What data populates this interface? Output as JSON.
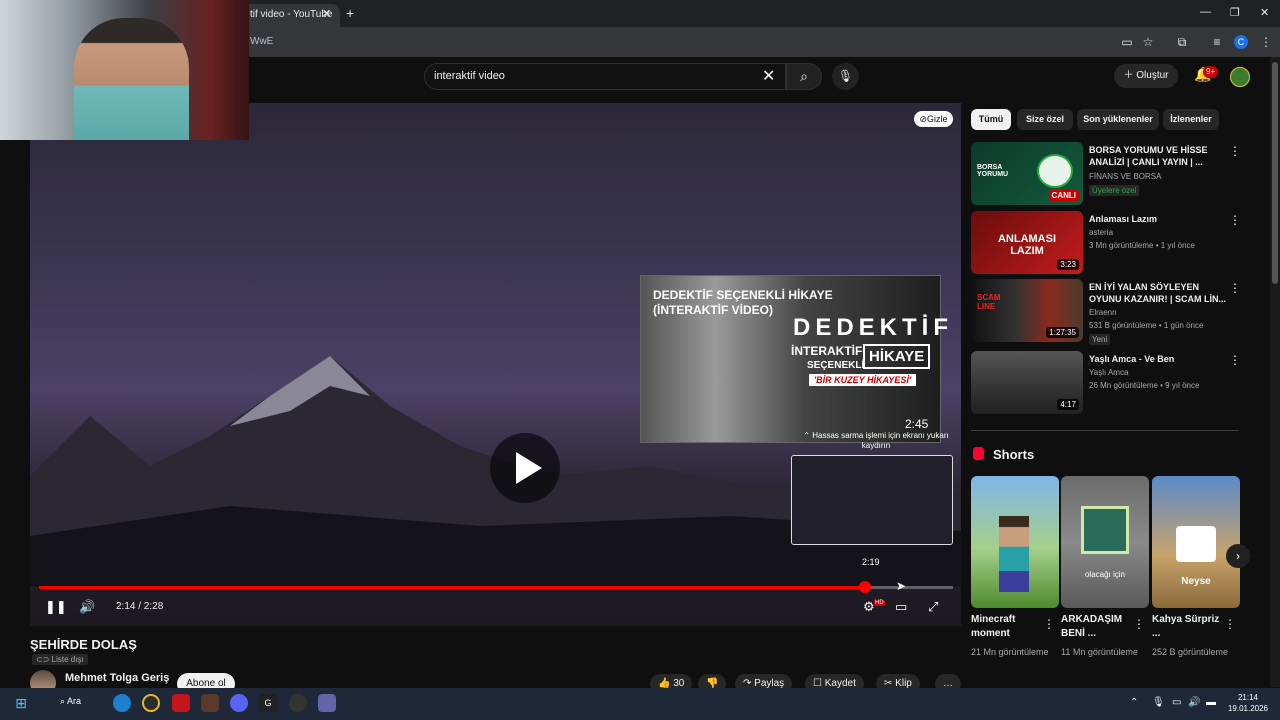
{
  "browser": {
    "tab_title": "tif video - YouTube",
    "tab_close": "✕",
    "new_tab": "+",
    "url": "WwE",
    "profile_initial": "C",
    "window_controls": [
      "—",
      "❐",
      "✕"
    ]
  },
  "header": {
    "search_value": "interaktif video",
    "search_clear": "✕",
    "create_label": "Oluştur",
    "notif_count": "9+"
  },
  "player": {
    "hide_label": "Gizle",
    "current_time": "2:14 / 2:28",
    "progress_fraction": 0.905,
    "preview_time": "2:19",
    "hd_badge": "HD"
  },
  "endcard": {
    "title": "DEDEKTİF SEÇENEKLİ HİKAYE (İNTERAKTİF VİDEO)",
    "big_word": "DEDEKTİF",
    "interaktif": "İNTERAKTİF",
    "hikaye": "HİKAYE",
    "secenekli": "SEÇENEKLİ",
    "tagline": "'BİR KUZEY HİKAYESİ'",
    "duration": "2:45",
    "scroll_note": "Hassas sarma işlemi için ekranı yukarı kaydırın"
  },
  "video": {
    "title": "ŞEHİRDE DOLAŞ",
    "visibility": "Liste dışı",
    "channel": "Mehmet Tolga Geriş",
    "subscribe": "Abone ol",
    "likes": "30",
    "share": "Paylaş",
    "save": "Kaydet",
    "clip": "Klip"
  },
  "sidebar": {
    "chips": [
      "Tümü",
      "Size özel",
      "Son yüklenenler",
      "İzlenenler"
    ],
    "recommendations": [
      {
        "title": "BORSA YORUMU VE HİSSE ANALİZİ | CANLI YAYIN | ...",
        "channel": "FİNANS VE BORSA",
        "meta": "",
        "badge": "Üyelere özel",
        "overlay": "CANLI"
      },
      {
        "title": "Anlaması Lazım",
        "channel": "asteria",
        "meta": "3 Mn görüntüleme • 1 yıl önce",
        "badge": "",
        "overlay": "3:23"
      },
      {
        "title": "EN İYİ YALAN SÖYLEYEN OYUNU KAZANIR! | SCAM LİN...",
        "channel": "Elraenn",
        "meta": "531 B görüntüleme • 1 gün önce",
        "badge": "Yeni",
        "overlay": "1:27:35"
      },
      {
        "title": "Yaşlı Amca - Ve Ben",
        "channel": "Yaşlı Amca",
        "meta": "26 Mn görüntüleme • 9 yıl önce",
        "badge": "",
        "overlay": "4:17"
      }
    ],
    "thumb_texts": {
      "borsa": "BORSA YORUMU",
      "anlamasi": "ANLAMASI LAZIM",
      "scam": "SCAM LINE"
    },
    "shorts_heading": "Shorts",
    "shorts": [
      {
        "title": "Minecraft moment",
        "views": "21 Mn görüntüleme",
        "overlay": ""
      },
      {
        "title": "ARKADAŞIM BENİ ...",
        "views": "11 Mn görüntüleme",
        "overlay": "olacağı için"
      },
      {
        "title": "Kahya Sürpriz ...",
        "views": "252 B görüntüleme",
        "overlay": "Neyse"
      }
    ]
  },
  "taskbar": {
    "search": "Ara",
    "time": "21:14",
    "date": "19.01.2026"
  },
  "colors": {
    "accent": "#ff0000",
    "background": "#0f0f0f",
    "chip_active": "#f1f1f1"
  }
}
